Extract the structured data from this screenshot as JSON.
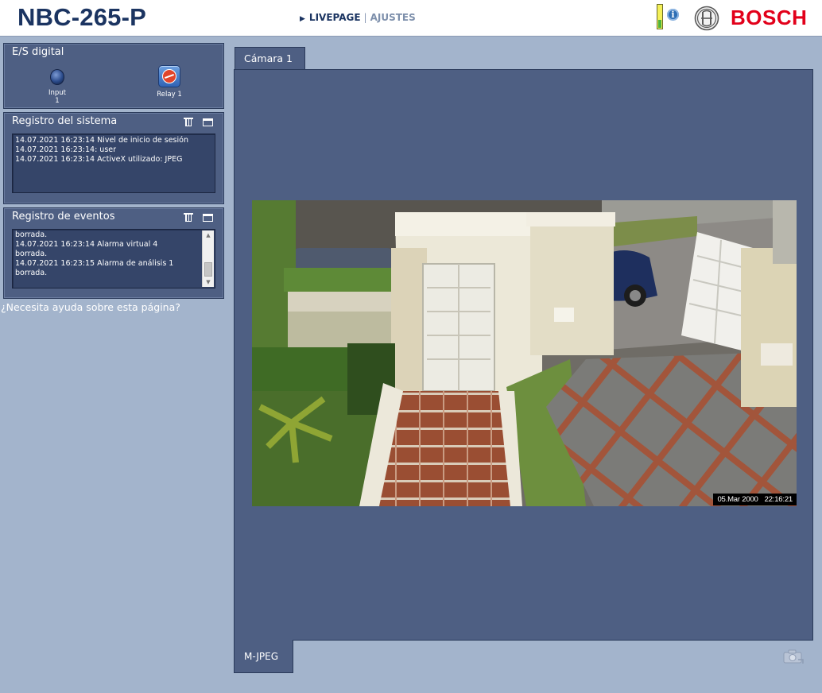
{
  "header": {
    "model": "NBC-265-P",
    "nav": {
      "livepage": "LIVEPAGE",
      "separator": "|",
      "ajustes": "AJUSTES"
    },
    "brand": "BOSCH"
  },
  "sidebar": {
    "digital_io": {
      "title": "E/S digital",
      "input_label": "Input 1",
      "relay_label": "Relay 1"
    },
    "system_log": {
      "title": "Registro del sistema",
      "lines": [
        "14.07.2021 16:23:14 Nivel de inicio de sesión",
        "14.07.2021 16:23:14: user",
        "14.07.2021 16:23:14 ActiveX utilizado: JPEG"
      ]
    },
    "event_log": {
      "title": "Registro de eventos",
      "lines": [
        "borrada.",
        "14.07.2021 16:23:14 Alarma virtual 4",
        "borrada.",
        "14.07.2021 16:23:15 Alarma de análisis 1",
        "borrada."
      ]
    },
    "help_link": "¿Necesita ayuda sobre esta página?"
  },
  "camera": {
    "tab_label": "Cámara 1",
    "stream_label": "M-JPEG",
    "osd_date": "05.Mar 2000",
    "osd_time": "22:16:21"
  },
  "icons": {
    "status": "signal-level-icon",
    "info": "info-icon",
    "brand_emblem": "bosch-armature-icon",
    "trash": "trash-icon",
    "window": "window-icon",
    "snapshot": "snapshot-icon"
  }
}
